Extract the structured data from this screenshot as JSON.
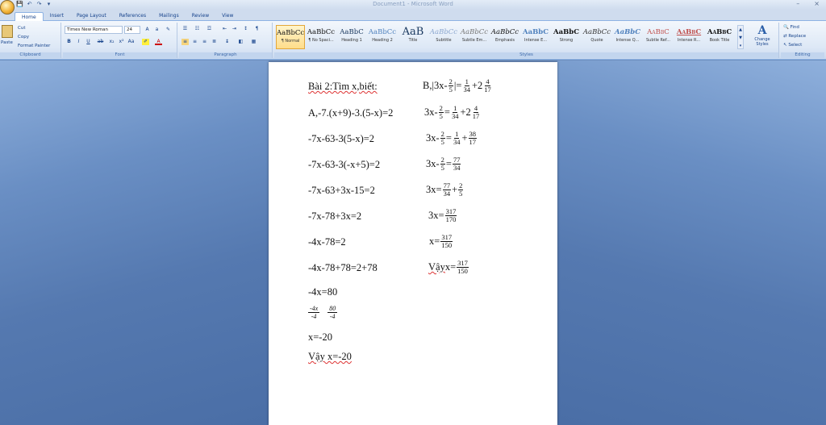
{
  "window": {
    "title": "Document1 - Microsoft Word",
    "minimize": "–",
    "close": "×"
  },
  "qat": {
    "save": "💾",
    "undo": "↶",
    "redo": "↷",
    "more": "▾"
  },
  "tabs": [
    "Home",
    "Insert",
    "Page Layout",
    "References",
    "Mailings",
    "Review",
    "View"
  ],
  "clipboard": {
    "paste": "Paste",
    "cut": "Cut",
    "copy": "Copy",
    "format_painter": "Format Painter",
    "label": "Clipboard"
  },
  "font": {
    "name": "Times New Roman",
    "size": "24",
    "label": "Font"
  },
  "paragraph": {
    "label": "Paragraph"
  },
  "styles": {
    "label": "Styles",
    "items": [
      {
        "preview": "AaBbCc",
        "name": "¶ Normal"
      },
      {
        "preview": "AaBbCc",
        "name": "¶ No Spaci..."
      },
      {
        "preview": "AaBbC",
        "name": "Heading 1"
      },
      {
        "preview": "AaBbCc",
        "name": "Heading 2"
      },
      {
        "preview": "AaB",
        "name": "Title"
      },
      {
        "preview": "AaBbCc",
        "name": "Subtitle"
      },
      {
        "preview": "AaBbCc",
        "name": "Subtle Em..."
      },
      {
        "preview": "AaBbCc",
        "name": "Emphasis"
      },
      {
        "preview": "AaBbC",
        "name": "Intense E..."
      },
      {
        "preview": "AaBbC",
        "name": "Strong"
      },
      {
        "preview": "AaBbCc",
        "name": "Quote"
      },
      {
        "preview": "AaBbC",
        "name": "Intense Q..."
      },
      {
        "preview": "AaBbC",
        "name": "Subtle Ref..."
      },
      {
        "preview": "AaBbC",
        "name": "Intense R..."
      },
      {
        "preview": "AaBbC",
        "name": "Book Title"
      }
    ],
    "change": "Change Styles"
  },
  "editing": {
    "find": "Find",
    "replace": "Replace",
    "select": "Select",
    "label": "Editing"
  },
  "document": {
    "heading": "Bài 2:Tìm x,biết:",
    "left": [
      "A,-7.(x+9)-3.(5-x)=2",
      "-7x-63-3(5-x)=2",
      "-7x-63-3(-x+5)=2",
      "-7x-63+3x-15=2",
      "-7x-78+3x=2",
      "-4x-78=2",
      "-4x-78+78=2+78",
      "-4x=80"
    ],
    "div_frac": {
      "n1": "-4x",
      "d1": "-4",
      "n2": "80",
      "d2": "-4"
    },
    "result": "x=-20",
    "conclusion": "Vậy x=-20",
    "right": {
      "r0_prefix": "B,|3x-",
      "r0_n1": "2",
      "r0_d1": "5",
      "r0_mid": "|=",
      "r0_n2": "1",
      "r0_d2": "34",
      "r0_plus": "+2",
      "r0_n3": "4",
      "r0_d3": "17",
      "r1_prefix": "3x-",
      "r1_n1": "2",
      "r1_d1": "5",
      "r1_eq": "=",
      "r1_n2": "1",
      "r1_d2": "34",
      "r1_plus": "+2",
      "r1_n3": "4",
      "r1_d3": "17",
      "r2_prefix": "3x-",
      "r2_n1": "2",
      "r2_d1": "5",
      "r2_eq": "=",
      "r2_n2": "1",
      "r2_d2": "34",
      "r2_plus": "+",
      "r2_n3": "38",
      "r2_d3": "17",
      "r3_prefix": "3x-",
      "r3_n1": "2",
      "r3_d1": "5",
      "r3_eq": "=",
      "r3_n2": "77",
      "r3_d2": "34",
      "r4_prefix": "3x=",
      "r4_n1": "77",
      "r4_d1": "34",
      "r4_plus": "+",
      "r4_n2": "2",
      "r4_d2": "5",
      "r5_prefix": "3x=",
      "r5_n": "317",
      "r5_d": "170",
      "r6_prefix": "x=",
      "r6_n": "317",
      "r6_d": "150",
      "r7_prefix_a": "Vậy",
      "r7_prefix_b": " x=",
      "r7_n": "317",
      "r7_d": "150"
    }
  }
}
